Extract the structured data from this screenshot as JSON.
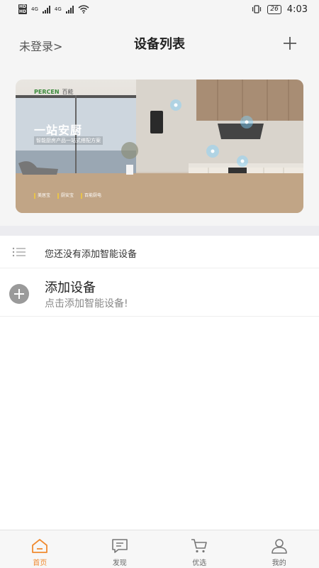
{
  "status_bar": {
    "sim1": "HD",
    "sim2": "HD",
    "net1": "4G",
    "net2": "4G",
    "battery": "26",
    "time": "4:03"
  },
  "header": {
    "login_link": "未登录>",
    "title": "设备列表",
    "add_icon": "plus-icon"
  },
  "banner": {
    "brand": "PERCEN",
    "brand_cn": "百能",
    "title": "一站安厨",
    "subtitle": "智能厨房产品一站式搭配方案",
    "tags": [
      "美居宝",
      "厨安宝",
      "百能厨电"
    ]
  },
  "device_list": {
    "empty_text": "您还没有添加智能设备",
    "add_title": "添加设备",
    "add_subtitle": "点击添加智能设备!"
  },
  "tabbar": {
    "active_color": "#f08a30",
    "items": [
      {
        "label": "首页",
        "icon": "home-icon"
      },
      {
        "label": "发现",
        "icon": "message-icon"
      },
      {
        "label": "优选",
        "icon": "cart-icon"
      },
      {
        "label": "我的",
        "icon": "user-icon"
      }
    ]
  }
}
